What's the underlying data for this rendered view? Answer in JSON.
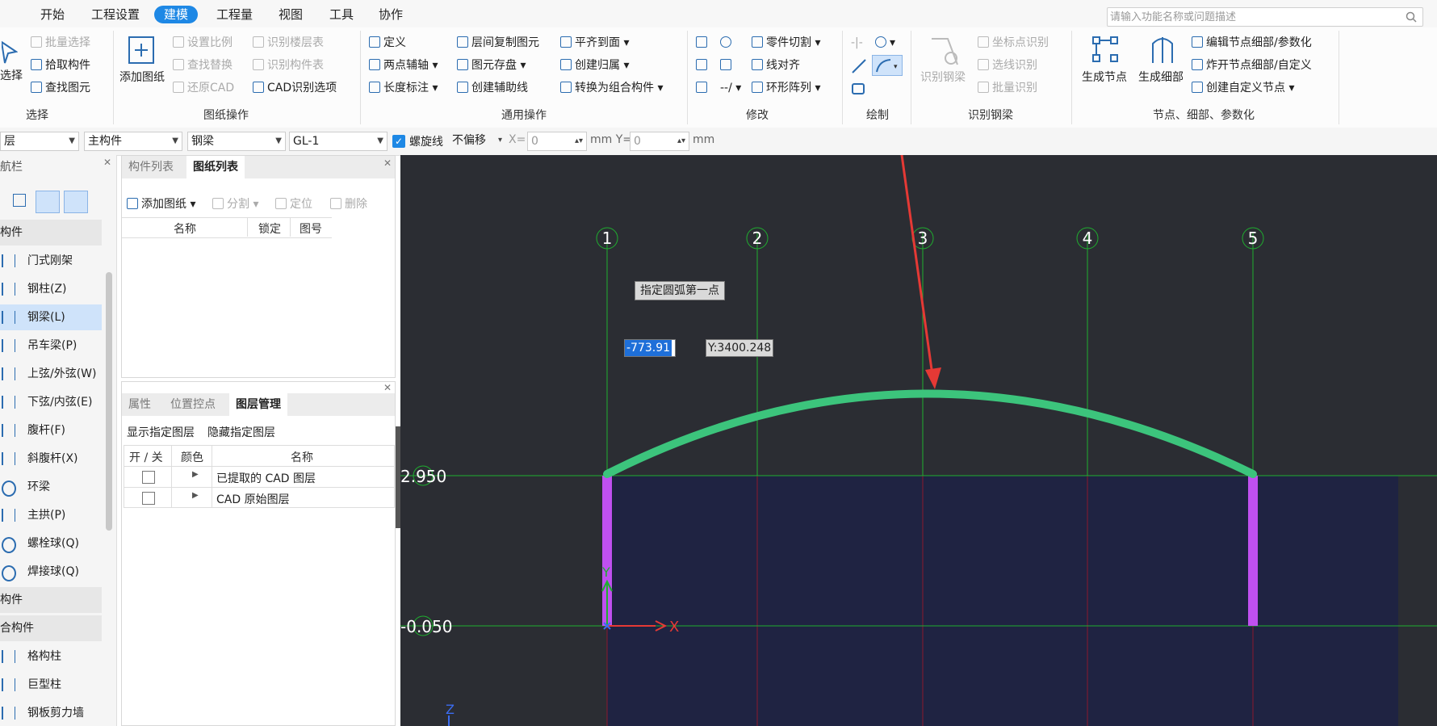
{
  "menubar": {
    "tabs": [
      "开始",
      "工程设置",
      "建模",
      "工程量",
      "视图",
      "工具",
      "协作"
    ],
    "active_tab": "建模",
    "search_placeholder": "请输入功能名称或问题描述"
  },
  "ribbon": {
    "select_group": {
      "big_button": "选择",
      "items": [
        "批量选择",
        "拾取构件",
        "查找图元"
      ],
      "group_label": "选择"
    },
    "drawing_group": {
      "big_button": "添加图纸",
      "items": [
        "设置比例",
        "查找替换",
        "还原CAD",
        "识别楼层表",
        "识别构件表",
        "CAD识别选项"
      ],
      "group_label": "图纸操作"
    },
    "common_group": {
      "items": [
        "定义",
        "两点辅轴",
        "长度标注",
        "层间复制图元",
        "图元存盘",
        "创建辅助线",
        "平齐到面",
        "创建归属",
        "转换为组合构件"
      ],
      "group_label": "通用操作"
    },
    "modify_group": {
      "items": [
        "零件切割",
        "线对齐",
        "环形阵列"
      ],
      "group_label": "修改"
    },
    "draw_group": {
      "group_label": "绘制"
    },
    "recognize_group": {
      "big_button": "识别钢梁",
      "items": [
        "坐标点识别",
        "选线识别",
        "批量识别"
      ],
      "group_label": "识别钢梁"
    },
    "node_group": {
      "buttons": [
        "生成节点",
        "生成细部"
      ],
      "items": [
        "编辑节点细部/参数化",
        "炸开节点细部/自定义",
        "创建自定义节点"
      ],
      "group_label": "节点、细部、参数化"
    }
  },
  "propbar": {
    "floor": "层",
    "category": "主构件",
    "type": "钢梁",
    "component": "GL-1",
    "spiral_label": "螺旋线",
    "spiral_checked": true,
    "offset": "不偏移",
    "x_label": "X=",
    "x_value": "0",
    "y_label": "mm Y=",
    "y_value": "0",
    "unit": "mm"
  },
  "nav": {
    "title": "航栏",
    "sections": [
      "构件",
      "构件",
      "合构件"
    ],
    "items": [
      "门式刚架",
      "钢柱(Z)",
      "钢梁(L)",
      "吊车梁(P)",
      "上弦/外弦(W)",
      "下弦/内弦(E)",
      "腹杆(F)",
      "斜腹杆(X)",
      "环梁",
      "主拱(P)",
      "螺栓球(Q)",
      "焊接球(Q)"
    ],
    "combo_items": [
      "格构柱",
      "巨型柱",
      "钢板剪力墙"
    ],
    "selected": "钢梁(L)"
  },
  "drawing_panel": {
    "tabs": [
      "构件列表",
      "图纸列表"
    ],
    "active_tab": "图纸列表",
    "toolbar": [
      "添加图纸",
      "分割",
      "定位",
      "删除"
    ],
    "columns": [
      "名称",
      "锁定",
      "图号"
    ]
  },
  "layer_panel": {
    "tabs": [
      "属性",
      "位置控点",
      "图层管理"
    ],
    "active_tab": "图层管理",
    "actions": [
      "显示指定图层",
      "隐藏指定图层"
    ],
    "columns": [
      "开 / 关",
      "颜色",
      "名称"
    ],
    "rows": [
      {
        "name": "已提取的 CAD 图层",
        "on": false
      },
      {
        "name": "CAD 原始图层",
        "on": false
      }
    ]
  },
  "canvas": {
    "axis_labels": [
      "1",
      "2",
      "3",
      "4",
      "5"
    ],
    "elevations": [
      "2.950",
      "-0.050"
    ],
    "tooltip": "指定圆弧第一点",
    "coord_x": "-773.91",
    "coord_y": "Y:3400.248",
    "x_axis": "X",
    "y_axis": "Y",
    "z_axis": "Z",
    "colors": {
      "background": "#2b2d33",
      "arc_beam": "#3cc47c",
      "columns": "#c050f0",
      "grid": "#1fae2f",
      "fill": "#1f2342",
      "arrow": "#e53935"
    }
  }
}
